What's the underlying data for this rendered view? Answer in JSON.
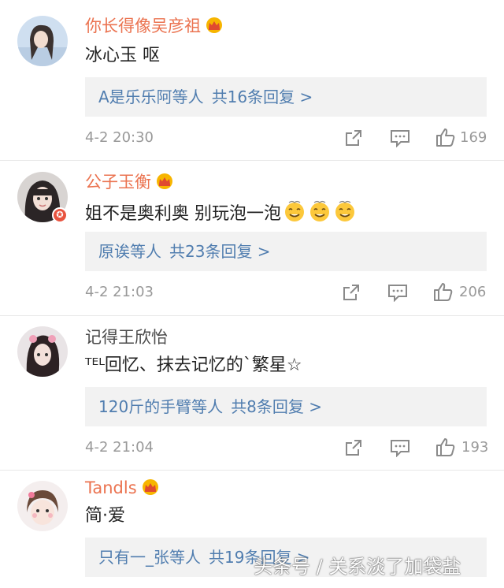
{
  "comments": [
    {
      "username": "你长得像吴彦祖",
      "text": "冰心玉 呕",
      "reply_users": "A是乐乐阿等人",
      "reply_count": "共16条回复 >",
      "time": "4-2 20:30",
      "likes": "169"
    },
    {
      "username": "公子玉衡",
      "text": "姐不是奥利奥  别玩泡一泡",
      "reply_users": "原诶等人",
      "reply_count": "共23条回复 >",
      "time": "4-2 21:03",
      "likes": "206"
    },
    {
      "username": "记得王欣怡",
      "text": "ᵀᴱᴸ回忆、抹去记忆的`繁星☆",
      "reply_users": "120斤的手臂等人",
      "reply_count": "共8条回复 >",
      "time": "4-2 21:04",
      "likes": "193"
    },
    {
      "username": "Tandls",
      "text": "简·爱",
      "reply_users": "只有一_张等人",
      "reply_count": "共19条回复 >"
    }
  ],
  "watermark": "头条号 / 关系淡了加袋盐",
  "colors": {
    "vip_name": "#eb7350",
    "link": "#507daf",
    "meta": "#999999",
    "reply_bg": "#f2f2f2"
  },
  "icons": [
    "crown-icon",
    "share-icon",
    "comment-icon",
    "like-icon",
    "dizzy-emoji-icon"
  ]
}
